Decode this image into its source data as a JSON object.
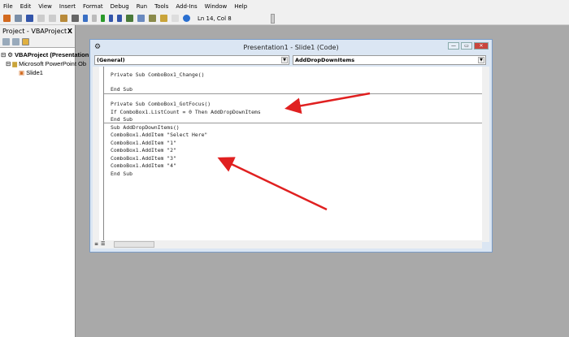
{
  "menu": [
    "File",
    "Edit",
    "View",
    "Insert",
    "Format",
    "Debug",
    "Run",
    "Tools",
    "Add-Ins",
    "Window",
    "Help"
  ],
  "toolbar": {
    "status": "Ln 14, Col 8",
    "icons": [
      "view-powerpoint-icon",
      "insert-icon",
      "save-icon",
      "cut-icon",
      "copy-icon",
      "paste-icon",
      "find-icon",
      "undo-icon",
      "redo-icon",
      "run-icon",
      "break-icon",
      "reset-icon",
      "design-mode-icon",
      "project-explorer-icon",
      "properties-icon",
      "object-browser-icon",
      "toolbox-icon",
      "help-icon"
    ]
  },
  "project": {
    "title": "Project - VBAProject",
    "close": "X",
    "tree": [
      "VBAProject (Presentation",
      "Microsoft PowerPoint Ob",
      "Slide1"
    ]
  },
  "code_window": {
    "title": "Presentation1 - Slide1 (Code)",
    "object_combo": "(General)",
    "proc_combo": "AddDropDownItems",
    "lines": [
      "Private Sub ComboBox1_Change()",
      "",
      "End Sub",
      "",
      "Private Sub ComboBox1_GotFocus()",
      "If ComboBox1.ListCount = 0 Then AddDropDownItems",
      "End Sub",
      "Sub AddDropDownItems()",
      "ComboBox1.AddItem \"Select Here\"",
      "ComboBox1.AddItem \"1\"",
      "ComboBox1.AddItem \"2\"",
      "ComboBox1.AddItem \"3\"",
      "ComboBox1.AddItem \"4\"",
      "End Sub"
    ]
  },
  "annotation_color": "#e02020"
}
